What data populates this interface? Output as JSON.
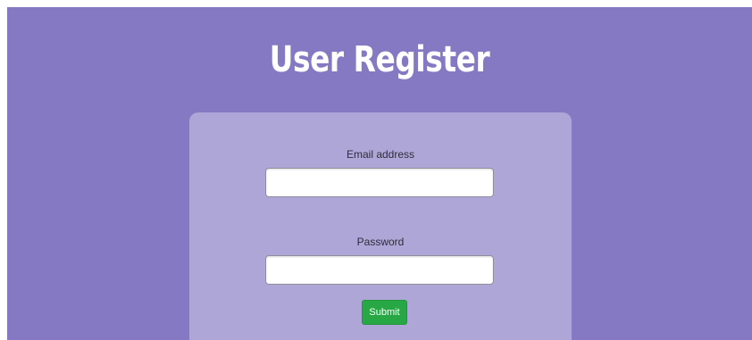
{
  "page": {
    "title": "User Register"
  },
  "form": {
    "email": {
      "label": "Email address",
      "value": "",
      "placeholder": ""
    },
    "password": {
      "label": "Password",
      "value": "",
      "placeholder": ""
    },
    "submit_label": "Submit"
  },
  "colors": {
    "background": "#8579c4",
    "card": "#afa6d8",
    "submit": "#28a745"
  }
}
